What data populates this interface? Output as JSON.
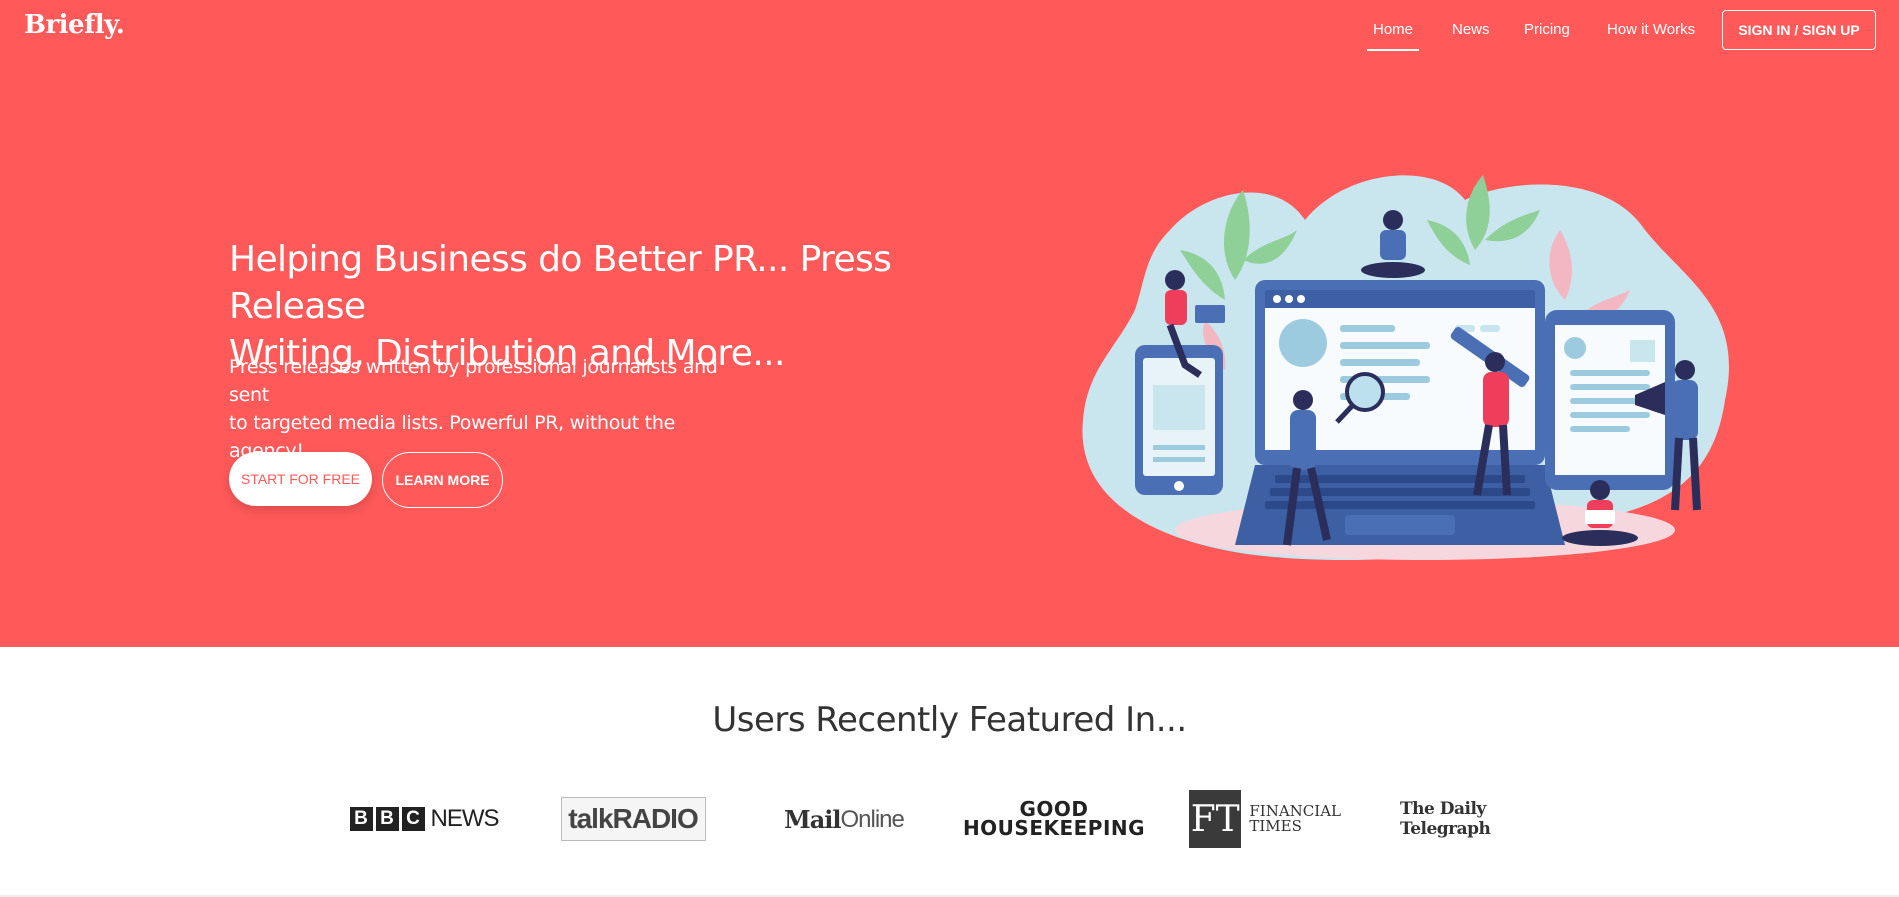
{
  "brand": {
    "name": "Briefly."
  },
  "nav": {
    "items": [
      {
        "label": "Home",
        "active": true
      },
      {
        "label": "News"
      },
      {
        "label": "Pricing"
      },
      {
        "label": "How it Works"
      }
    ],
    "signin_label": "SIGN IN / SIGN UP"
  },
  "hero": {
    "title_line1": "Helping Business do Better PR... Press Release",
    "title_line2": "Writing, Distribution and More...",
    "subtitle_line1": "Press releases written by professional journalists and sent",
    "subtitle_line2": "to targeted media lists. Powerful PR, without the agency!",
    "start_label": "START FOR FREE",
    "learn_label": "LEARN MORE"
  },
  "featured": {
    "title": "Users Recently Featured In...",
    "logos": {
      "bbc_letters": [
        "B",
        "B",
        "C"
      ],
      "bbc_news": "NEWS",
      "talkradio": "talkRADIO",
      "mail_bold": "Mail",
      "mail_online": "Online",
      "gh_line1": "GOOD",
      "gh_line2": "HOUSEKEEPING",
      "ft_mark": "FT",
      "ft_line1": "FINANCIAL",
      "ft_line2": "TIMES",
      "telegraph": "The Daily Telegraph"
    }
  },
  "colors": {
    "hero_bg": "#ff5959",
    "accent": "#ff5959",
    "illustration_blob": "#c9e6ef",
    "device_blue": "#4a6fb5",
    "dark_navy": "#2b2e5a"
  }
}
